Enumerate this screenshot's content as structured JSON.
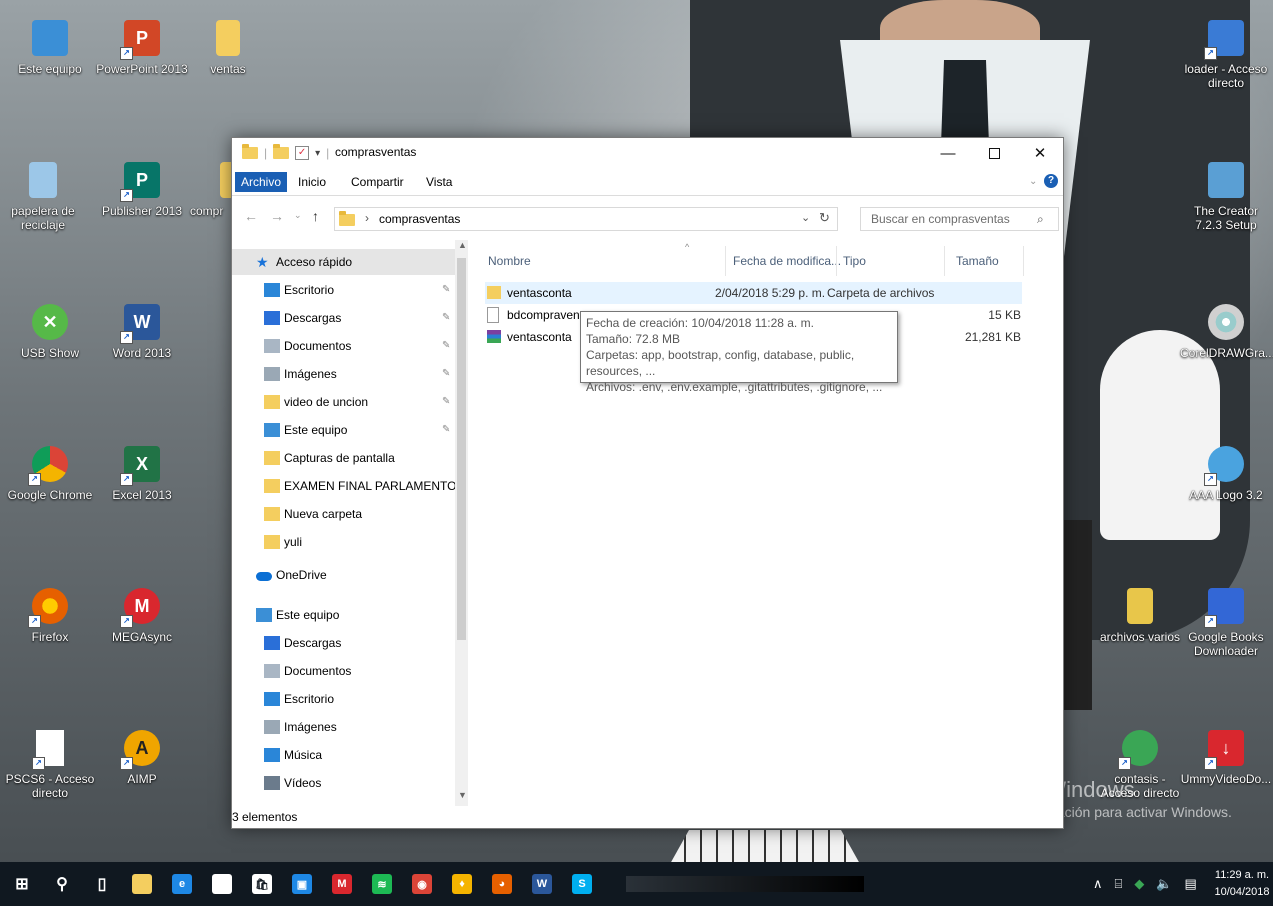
{
  "desktop": {
    "icons": [
      {
        "label": "Este equipo",
        "icon": "computer-icon",
        "color": "#3b8fd6",
        "glyph": ""
      },
      {
        "label": "PowerPoint 2013",
        "icon": "powerpoint-icon",
        "color": "#d24726",
        "glyph": "P"
      },
      {
        "label": "ventas",
        "icon": "folder-icon",
        "color": "#f4ce5f",
        "glyph": ""
      },
      {
        "label": "papelera de reciclaje",
        "icon": "recycle-bin-icon",
        "color": "#9cc7e8",
        "glyph": ""
      },
      {
        "label": "Publisher 2013",
        "icon": "publisher-icon",
        "color": "#077568",
        "glyph": "P"
      },
      {
        "label": "compr",
        "icon": "folder-icon",
        "color": "#f4ce5f",
        "glyph": ""
      },
      {
        "label": "USB Show",
        "icon": "usb-show-icon",
        "color": "#56b948",
        "glyph": "✕"
      },
      {
        "label": "Word 2013",
        "icon": "word-icon",
        "color": "#2b579a",
        "glyph": "W"
      },
      {
        "label": "Google Chrome",
        "icon": "chrome-icon",
        "color": "#db4437",
        "glyph": ""
      },
      {
        "label": "Excel 2013",
        "icon": "excel-icon",
        "color": "#217346",
        "glyph": "X"
      },
      {
        "label": "Firefox",
        "icon": "firefox-icon",
        "color": "#e66000",
        "glyph": ""
      },
      {
        "label": "MEGAsync",
        "icon": "mega-icon",
        "color": "#d9272e",
        "glyph": "M"
      },
      {
        "label": "PSCS6 - Acceso directo",
        "icon": "file-icon",
        "color": "#ffffff",
        "glyph": ""
      },
      {
        "label": "AIMP",
        "icon": "aimp-icon",
        "color": "#f0a500",
        "glyph": "A"
      },
      {
        "label": "loader - Acceso directo",
        "icon": "loader-icon",
        "color": "#3a7bd5",
        "glyph": ""
      },
      {
        "label": "The Creator 7.2.3 Setup",
        "icon": "installer-icon",
        "color": "#5a9fd4",
        "glyph": ""
      },
      {
        "label": "CorelDRAWGra...",
        "icon": "corel-disc-icon",
        "color": "#d0d0d0",
        "glyph": ""
      },
      {
        "label": "AAA Logo 3.2",
        "icon": "aaa-logo-icon",
        "color": "#4aa3df",
        "glyph": ""
      },
      {
        "label": "archivos varios",
        "icon": "zip-folder-icon",
        "color": "#e8c64a",
        "glyph": ""
      },
      {
        "label": "Google Books Downloader",
        "icon": "books-icon",
        "color": "#3367d6",
        "glyph": ""
      },
      {
        "label": "contasis - Acceso directo",
        "icon": "contasis-icon",
        "color": "#3aa655",
        "glyph": ""
      },
      {
        "label": "UmmyVideoDo...",
        "icon": "ummy-icon",
        "color": "#d9272e",
        "glyph": "↓"
      }
    ],
    "watermark": {
      "line1": "Activar Windows",
      "line2": "Ve a Configuración para activar Windows."
    }
  },
  "explorer": {
    "title": "comprasventas",
    "ribbon_tabs": [
      "Archivo",
      "Inicio",
      "Compartir",
      "Vista"
    ],
    "address": {
      "separator": "›",
      "path": "comprasventas"
    },
    "search_placeholder": "Buscar en comprasventas",
    "nav_items": [
      {
        "label": "Acceso rápido",
        "icon": "star-icon",
        "pinned": false,
        "level": 0,
        "selected": true
      },
      {
        "label": "Escritorio",
        "icon": "desktop-icon",
        "pinned": true,
        "level": 1
      },
      {
        "label": "Descargas",
        "icon": "download-icon",
        "pinned": true,
        "level": 1
      },
      {
        "label": "Documentos",
        "icon": "documents-icon",
        "pinned": true,
        "level": 1
      },
      {
        "label": "Imágenes",
        "icon": "pictures-icon",
        "pinned": true,
        "level": 1
      },
      {
        "label": "video de uncion",
        "icon": "folder-icon",
        "pinned": true,
        "level": 1
      },
      {
        "label": "Este equipo",
        "icon": "computer-icon",
        "pinned": true,
        "level": 1
      },
      {
        "label": "Capturas de pantalla",
        "icon": "folder-icon",
        "pinned": false,
        "level": 1
      },
      {
        "label": "EXAMEN FINAL PARLAMENTO",
        "icon": "folder-icon",
        "pinned": false,
        "level": 1
      },
      {
        "label": "Nueva carpeta",
        "icon": "folder-icon",
        "pinned": false,
        "level": 1
      },
      {
        "label": "yuli",
        "icon": "folder-icon",
        "pinned": false,
        "level": 1
      },
      {
        "label": "OneDrive",
        "icon": "onedrive-icon",
        "pinned": false,
        "level": 0
      },
      {
        "label": "Este equipo",
        "icon": "computer-icon",
        "pinned": false,
        "level": 0
      },
      {
        "label": "Descargas",
        "icon": "download-icon",
        "pinned": false,
        "level": 1
      },
      {
        "label": "Documentos",
        "icon": "documents-icon",
        "pinned": false,
        "level": 1
      },
      {
        "label": "Escritorio",
        "icon": "desktop-icon",
        "pinned": false,
        "level": 1
      },
      {
        "label": "Imágenes",
        "icon": "pictures-icon",
        "pinned": false,
        "level": 1
      },
      {
        "label": "Música",
        "icon": "music-icon",
        "pinned": false,
        "level": 1
      },
      {
        "label": "Vídeos",
        "icon": "videos-icon",
        "pinned": false,
        "level": 1
      }
    ],
    "columns": [
      "Nombre",
      "Fecha de modifica...",
      "Tipo",
      "Tamaño"
    ],
    "files": [
      {
        "name": "ventasconta",
        "date": "2/04/2018 5:29 p. m.",
        "type": "Carpeta de archivos",
        "size": "",
        "icon": "folder-icon",
        "highlighted": true
      },
      {
        "name": "bdcompravent",
        "date": "",
        "type": "",
        "size": "15 KB",
        "icon": "file-icon",
        "highlighted": false
      },
      {
        "name": "ventasconta",
        "date": "",
        "type": "RAR",
        "size": "21,281 KB",
        "icon": "rar-icon",
        "highlighted": false
      }
    ],
    "tooltip": [
      "Fecha de creación: 10/04/2018 11:28 a. m.",
      "Tamaño: 72.8 MB",
      "Carpetas: app, bootstrap, config, database, public, resources, ...",
      "Archivos: .env, .env.example, .gitattributes, .gitignore, ..."
    ],
    "status": "3 elementos"
  },
  "taskbar": {
    "apps": [
      {
        "icon": "windows-start-icon",
        "color": "#ffffff",
        "glyph": "⊞"
      },
      {
        "icon": "search-icon",
        "color": "#ffffff",
        "glyph": "⚲"
      },
      {
        "icon": "task-view-icon",
        "color": "#ffffff",
        "glyph": "▯"
      },
      {
        "icon": "file-explorer-icon",
        "color": "#f4ce5f",
        "glyph": ""
      },
      {
        "icon": "edge-icon",
        "color": "#1e88e5",
        "glyph": "e"
      },
      {
        "icon": "file-icon",
        "color": "#ffffff",
        "glyph": ""
      },
      {
        "icon": "store-icon",
        "color": "#ffffff",
        "glyph": "🛍"
      },
      {
        "icon": "film-icon",
        "color": "#1e88e5",
        "glyph": "▣"
      },
      {
        "icon": "mega-icon",
        "color": "#d9272e",
        "glyph": "M"
      },
      {
        "icon": "spotify-icon",
        "color": "#1db954",
        "glyph": "≋"
      },
      {
        "icon": "chrome-icon",
        "color": "#db4437",
        "glyph": "◉"
      },
      {
        "icon": "parrot-icon",
        "color": "#f5b400",
        "glyph": "♦"
      },
      {
        "icon": "firefox-icon",
        "color": "#e66000",
        "glyph": "◕"
      },
      {
        "icon": "word-icon",
        "color": "#2b579a",
        "glyph": "W"
      },
      {
        "icon": "skype-icon",
        "color": "#00aff0",
        "glyph": "S"
      }
    ],
    "time": "11:29 a. m.",
    "date": "10/04/2018"
  }
}
